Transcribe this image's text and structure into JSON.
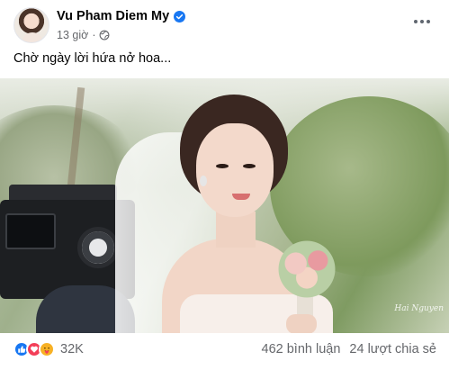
{
  "post": {
    "author": "Vu Pham Diem My",
    "timestamp": "13 giờ",
    "separator": "·",
    "privacy_icon": "globe-icon",
    "verified_icon": "verified-badge-icon",
    "more_icon": "more-horizontal-icon",
    "text": "Chờ ngày lời hứa nở hoa...",
    "photo_watermark": "Hai Nguyen"
  },
  "footer": {
    "reactions": [
      "like-icon",
      "love-icon",
      "care-icon"
    ],
    "reaction_count": "32K",
    "comments": "462 bình luận",
    "shares": "24 lượt chia sẻ"
  },
  "colors": {
    "brand_blue": "#1877f2",
    "love_red": "#f33e58",
    "care_yellow": "#f7b125",
    "secondary_text": "#65676b"
  }
}
